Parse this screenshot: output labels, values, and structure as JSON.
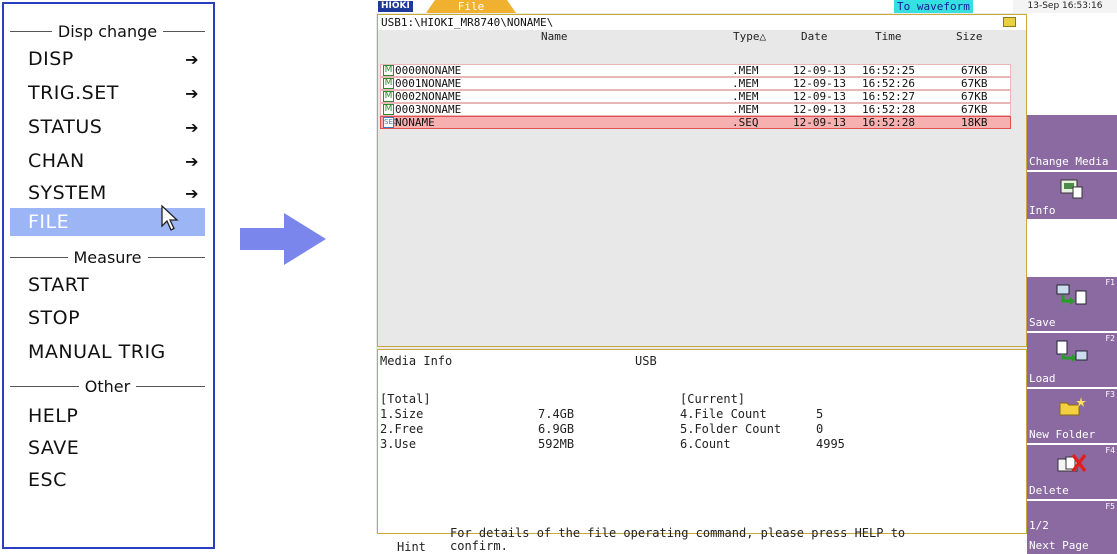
{
  "menu": {
    "sections": [
      {
        "title": "Disp change"
      },
      {
        "title": "Measure"
      },
      {
        "title": "Other"
      }
    ],
    "items_disp": [
      {
        "label": "DISP",
        "arrow": "➔"
      },
      {
        "label": "TRIG.SET",
        "arrow": "➔"
      },
      {
        "label": "STATUS",
        "arrow": "➔"
      },
      {
        "label": "CHAN",
        "arrow": "➔"
      },
      {
        "label": "SYSTEM",
        "arrow": "➔"
      },
      {
        "label": "FILE",
        "selected": true
      }
    ],
    "items_measure": [
      {
        "label": "START"
      },
      {
        "label": "STOP"
      },
      {
        "label": "MANUAL TRIG"
      }
    ],
    "items_other": [
      {
        "label": "HELP"
      },
      {
        "label": "SAVE"
      },
      {
        "label": "ESC"
      }
    ]
  },
  "device": {
    "brand": "HIOKI",
    "tab": "File",
    "to_waveform": "To waveform",
    "datetime": "13-Sep 16:53:16",
    "path": "USB1:\\HIOKI_MR8740\\NONAME\\",
    "columns": {
      "name": "Name",
      "type": "Type",
      "sort_glyph": "△",
      "date": "Date",
      "time": "Time",
      "size": "Size"
    },
    "files": [
      {
        "icon": "M",
        "name": "0000NONAME",
        "type": ".MEM",
        "date": "12-09-13",
        "time": "16:52:25",
        "size": "67KB"
      },
      {
        "icon": "M",
        "name": "0001NONAME",
        "type": ".MEM",
        "date": "12-09-13",
        "time": "16:52:26",
        "size": "67KB"
      },
      {
        "icon": "M",
        "name": "0002NONAME",
        "type": ".MEM",
        "date": "12-09-13",
        "time": "16:52:27",
        "size": "67KB"
      },
      {
        "icon": "M",
        "name": "0003NONAME",
        "type": ".MEM",
        "date": "12-09-13",
        "time": "16:52:28",
        "size": "67KB"
      },
      {
        "icon": "SEQ",
        "name": "NONAME",
        "type": ".SEQ",
        "date": "12-09-13",
        "time": "16:52:28",
        "size": "18KB",
        "selected": true
      }
    ],
    "media_info": {
      "title": "Media Info",
      "media": "USB",
      "total_label": "[Total]",
      "current_label": "[Current]",
      "total": [
        {
          "label": "1.Size",
          "value": "7.4GB"
        },
        {
          "label": "2.Free",
          "value": "6.9GB"
        },
        {
          "label": "3.Use",
          "value": "592MB"
        }
      ],
      "current": [
        {
          "label": "4.File Count",
          "value": "5"
        },
        {
          "label": "5.Folder Count",
          "value": "0"
        },
        {
          "label": "6.Count",
          "value": "4995"
        }
      ]
    },
    "hint": {
      "label": "Hint",
      "line1": "For details of the file operating command, please press HELP to",
      "line2": "confirm."
    },
    "function_keys": [
      {
        "label": "Change Media",
        "num": ""
      },
      {
        "label": "Info",
        "num": ""
      },
      {
        "label": "Save",
        "num": "F1"
      },
      {
        "label": "Load",
        "num": "F2"
      },
      {
        "label": "New Folder",
        "num": "F3"
      },
      {
        "label": "Delete",
        "num": "F4"
      },
      {
        "label": "1/2",
        "num": "F5"
      },
      {
        "label": "Next Page",
        "num": ""
      }
    ]
  },
  "colors": {
    "menu_border": "#2a3fc0",
    "menu_selected": "#9cb5f5",
    "arrow": "#7a86ec",
    "file_tab": "#f0b030",
    "function_key": "#8a6aa0",
    "selected_row": "#f6b0b0"
  }
}
